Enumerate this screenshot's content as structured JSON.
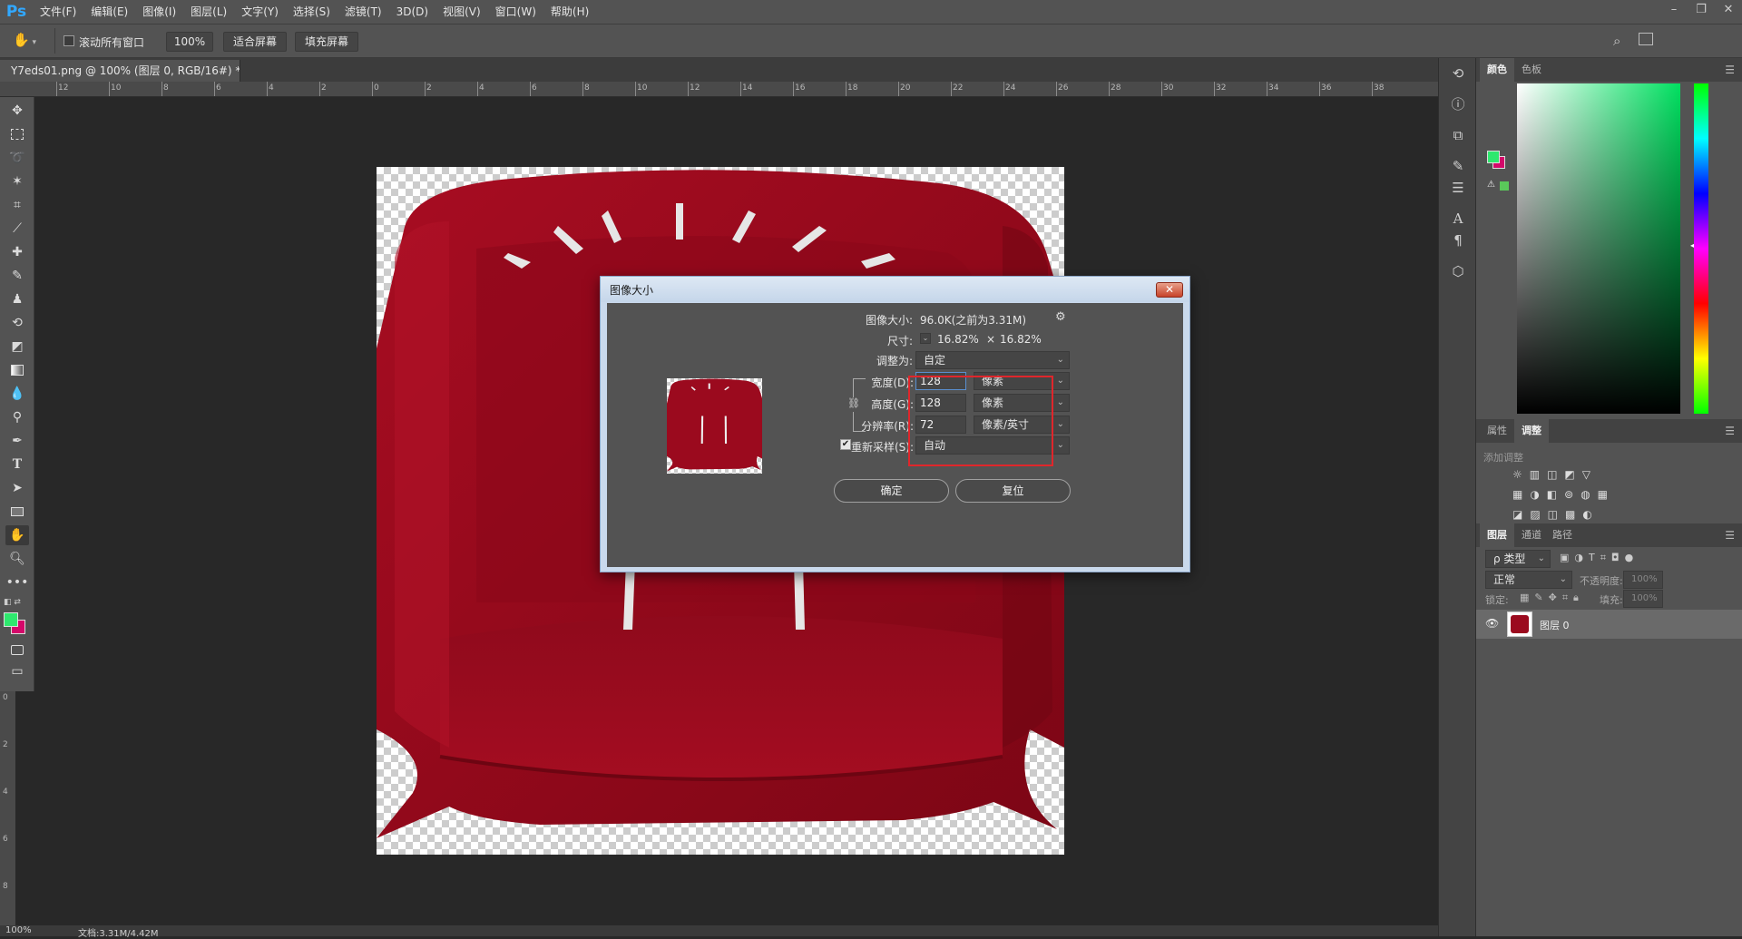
{
  "app": {
    "logo": "Ps"
  },
  "menu": [
    "文件(F)",
    "编辑(E)",
    "图像(I)",
    "图层(L)",
    "文字(Y)",
    "选择(S)",
    "滤镜(T)",
    "3D(D)",
    "视图(V)",
    "窗口(W)",
    "帮助(H)"
  ],
  "window_controls": {
    "minimize": "–",
    "restore": "❐",
    "close": "✕"
  },
  "options_bar": {
    "tool_icon": "hand-icon",
    "scroll_all_label": "滚动所有窗口",
    "scroll_all_checked": false,
    "zoom_value": "100%",
    "fit_screen": "适合屏幕",
    "fill_screen": "填充屏幕"
  },
  "document": {
    "tab_title": "Y7eds01.png @ 100% (图层 0, RGB/16#) *",
    "tab_close": "×"
  },
  "ruler_top_labels": [
    "12",
    "10",
    "8",
    "6",
    "4",
    "2",
    "0",
    "2",
    "4",
    "6",
    "8",
    "10",
    "12",
    "14",
    "16",
    "18",
    "20",
    "22",
    "24",
    "26",
    "28",
    "30",
    "32",
    "34",
    "36",
    "38"
  ],
  "ruler_left_labels": [
    "0",
    "2",
    "4",
    "6",
    "8"
  ],
  "statusbar": {
    "zoom": "100%",
    "doc": "文档:3.31M/4.42M"
  },
  "dialog": {
    "title": "图像大小",
    "close_icon": "close-icon",
    "image_size_label": "图像大小:",
    "image_size_value": "96.0K(之前为3.31M)",
    "dimensions_label": "尺寸:",
    "dimensions_w": "16.82%",
    "dimensions_x": "×",
    "dimensions_h": "16.82%",
    "fit_to_label": "调整为:",
    "fit_to_value": "自定",
    "width_label": "宽度(D):",
    "width_value": "128",
    "width_unit": "像素",
    "height_label": "高度(G):",
    "height_value": "128",
    "height_unit": "像素",
    "resolution_label": "分辨率(R):",
    "resolution_value": "72",
    "resolution_unit": "像素/英寸",
    "resample_label": "重新采样(S):",
    "resample_checked": true,
    "resample_value": "自动",
    "ok": "确定",
    "reset": "复位"
  },
  "panels": {
    "color_tabs": [
      "颜色",
      "色板"
    ],
    "foreground": "#2ee86e",
    "background": "#d4086a",
    "adjust_tabs": [
      "属性",
      "调整"
    ],
    "adjust_title": "添加调整",
    "layers_tabs": [
      "图层",
      "通道",
      "路径"
    ],
    "filter_kind": "ρ 类型",
    "blend_mode": "正常",
    "opacity_label": "不透明度:",
    "opacity_value": "100%",
    "lock_label": "锁定:",
    "fill_label": "填充:",
    "fill_value": "100%",
    "layer_name": "图层 0"
  },
  "colors": {
    "chair": "#9b0a1e",
    "highlight": "#e0262b"
  }
}
